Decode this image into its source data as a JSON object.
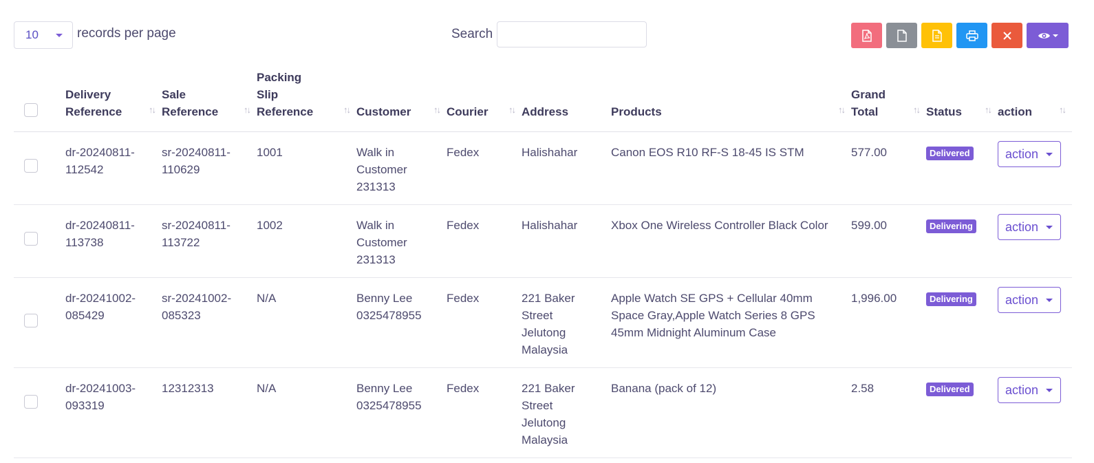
{
  "controls": {
    "page_length": "10",
    "page_length_label": "records per page",
    "search_label": "Search",
    "search_value": ""
  },
  "toolbar": [
    {
      "name": "pdf-export-button",
      "icon": "pdf-icon",
      "color": "#f26d7d"
    },
    {
      "name": "csv-export-button",
      "icon": "file-icon",
      "color": "#8a8f96"
    },
    {
      "name": "excel-export-button",
      "icon": "document-icon",
      "color": "#ffc107"
    },
    {
      "name": "print-button",
      "icon": "printer-icon",
      "color": "#2196f3"
    },
    {
      "name": "delete-button",
      "icon": "close-icon",
      "color": "#ea5a3c"
    },
    {
      "name": "column-visibility-button",
      "icon": "eye-icon",
      "color": "#7c5cd6"
    }
  ],
  "columns": [
    {
      "key": "select",
      "label": ""
    },
    {
      "key": "delivery_reference",
      "label": "Delivery Reference"
    },
    {
      "key": "sale_reference",
      "label": "Sale Reference"
    },
    {
      "key": "packing_slip_reference",
      "label": "Packing Slip Reference"
    },
    {
      "key": "customer",
      "label": "Customer"
    },
    {
      "key": "courier",
      "label": "Courier"
    },
    {
      "key": "address",
      "label": "Address"
    },
    {
      "key": "products",
      "label": "Products"
    },
    {
      "key": "grand_total",
      "label": "Grand Total"
    },
    {
      "key": "status",
      "label": "Status"
    },
    {
      "key": "action",
      "label": "action"
    }
  ],
  "rows": [
    {
      "delivery_reference": "dr-20240811-112542",
      "sale_reference": "sr-20240811-110629",
      "packing_slip_reference": "1001",
      "customer": "Walk in Customer 231313",
      "courier": "Fedex",
      "address": "Halishahar",
      "products": "Canon EOS R10 RF-S 18-45 IS STM",
      "grand_total": "577.00",
      "status": "Delivered",
      "action": "action"
    },
    {
      "delivery_reference": "dr-20240811-113738",
      "sale_reference": "sr-20240811-113722",
      "packing_slip_reference": "1002",
      "customer": "Walk in Customer 231313",
      "courier": "Fedex",
      "address": "Halishahar",
      "products": "Xbox One Wireless Controller Black Color",
      "grand_total": "599.00",
      "status": "Delivering",
      "action": "action"
    },
    {
      "delivery_reference": "dr-20241002-085429",
      "sale_reference": "sr-20241002-085323",
      "packing_slip_reference": "N/A",
      "customer": "Benny Lee 0325478955",
      "courier": "Fedex",
      "address": "221 Baker Street Jelutong Malaysia",
      "products": "Apple Watch SE GPS + Cellular 40mm Space Gray,Apple Watch Series 8 GPS 45mm Midnight Aluminum Case",
      "grand_total": "1,996.00",
      "status": "Delivering",
      "action": "action"
    },
    {
      "delivery_reference": "dr-20241003-093319",
      "sale_reference": "12312313",
      "packing_slip_reference": "N/A",
      "customer": "Benny Lee 0325478955",
      "courier": "Fedex",
      "address": "221 Baker Street Jelutong Malaysia",
      "products": "Banana (pack of 12)",
      "grand_total": "2.58",
      "status": "Delivered",
      "action": "action"
    }
  ],
  "sort_icon": "sort-icon",
  "colors": {
    "accent": "#7c5cd6",
    "text": "#4d4a6e"
  }
}
